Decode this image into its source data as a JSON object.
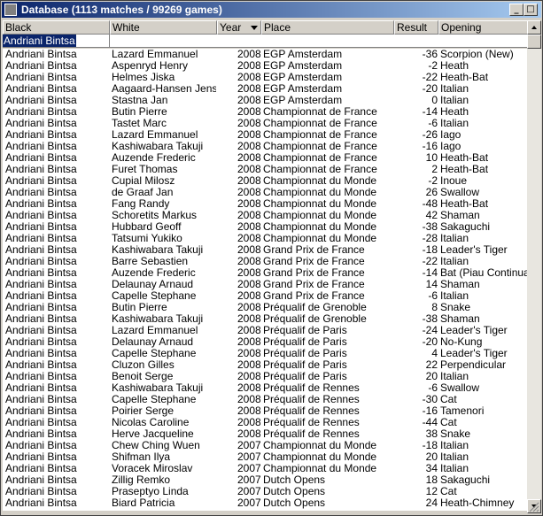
{
  "window": {
    "title": "Database (1113 matches / 99269 games)",
    "min_label": "_",
    "max_label": "□",
    "close_label": "×"
  },
  "columns": [
    "Black",
    "White",
    "Year",
    "Place",
    "Result",
    "Opening"
  ],
  "filter": {
    "black": "Andriani Bintsa"
  },
  "rows": [
    [
      "Andriani Bintsa",
      "Lazard Emmanuel",
      "2008",
      "EGP Amsterdam",
      "-36",
      "Scorpion (New)"
    ],
    [
      "Andriani Bintsa",
      "Aspenryd Henry",
      "2008",
      "EGP Amsterdam",
      "-2",
      "Heath"
    ],
    [
      "Andriani Bintsa",
      "Helmes Jiska",
      "2008",
      "EGP Amsterdam",
      "-22",
      "Heath-Bat"
    ],
    [
      "Andriani Bintsa",
      "Aagaard-Hansen Jens",
      "2008",
      "EGP Amsterdam",
      "-20",
      "Italian"
    ],
    [
      "Andriani Bintsa",
      "Stastna Jan",
      "2008",
      "EGP Amsterdam",
      "0",
      "Italian"
    ],
    [
      "Andriani Bintsa",
      "Butin Pierre",
      "2008",
      "Championnat de France",
      "-14",
      "Heath"
    ],
    [
      "Andriani Bintsa",
      "Tastet Marc",
      "2008",
      "Championnat de France",
      "-6",
      "Italian"
    ],
    [
      "Andriani Bintsa",
      "Lazard Emmanuel",
      "2008",
      "Championnat de France",
      "-26",
      "Iago"
    ],
    [
      "Andriani Bintsa",
      "Kashiwabara Takuji",
      "2008",
      "Championnat de France",
      "-16",
      "Iago"
    ],
    [
      "Andriani Bintsa",
      "Auzende Frederic",
      "2008",
      "Championnat de France",
      "10",
      "Heath-Bat"
    ],
    [
      "Andriani Bintsa",
      "Furet Thomas",
      "2008",
      "Championnat de France",
      "2",
      "Heath-Bat"
    ],
    [
      "Andriani Bintsa",
      "Cupial Milosz",
      "2008",
      "Championnat du Monde",
      "-2",
      "Inoue"
    ],
    [
      "Andriani Bintsa",
      "de Graaf Jan",
      "2008",
      "Championnat du Monde",
      "26",
      "Swallow"
    ],
    [
      "Andriani Bintsa",
      "Fang Randy",
      "2008",
      "Championnat du Monde",
      "-48",
      "Heath-Bat"
    ],
    [
      "Andriani Bintsa",
      "Schoretits Markus",
      "2008",
      "Championnat du Monde",
      "42",
      "Shaman"
    ],
    [
      "Andriani Bintsa",
      "Hubbard Geoff",
      "2008",
      "Championnat du Monde",
      "-38",
      "Sakaguchi"
    ],
    [
      "Andriani Bintsa",
      "Tatsumi Yukiko",
      "2008",
      "Championnat du Monde",
      "-28",
      "Italian"
    ],
    [
      "Andriani Bintsa",
      "Kashiwabara Takuji",
      "2008",
      "Grand Prix de France",
      "-18",
      "Leader's Tiger"
    ],
    [
      "Andriani Bintsa",
      "Barre Sebastien",
      "2008",
      "Grand Prix de France",
      "-22",
      "Italian"
    ],
    [
      "Andriani Bintsa",
      "Auzende Frederic",
      "2008",
      "Grand Prix de France",
      "-14",
      "Bat (Piau Continuatio"
    ],
    [
      "Andriani Bintsa",
      "Delaunay Arnaud",
      "2008",
      "Grand Prix de France",
      "14",
      "Shaman"
    ],
    [
      "Andriani Bintsa",
      "Capelle Stephane",
      "2008",
      "Grand Prix de France",
      "-6",
      "Italian"
    ],
    [
      "Andriani Bintsa",
      "Butin Pierre",
      "2008",
      "Préqualif de Grenoble",
      "8",
      "Snake"
    ],
    [
      "Andriani Bintsa",
      "Kashiwabara Takuji",
      "2008",
      "Préqualif de Grenoble",
      "-38",
      "Shaman"
    ],
    [
      "Andriani Bintsa",
      "Lazard Emmanuel",
      "2008",
      "Préqualif de Paris",
      "-24",
      "Leader's Tiger"
    ],
    [
      "Andriani Bintsa",
      "Delaunay Arnaud",
      "2008",
      "Préqualif de Paris",
      "-20",
      "No-Kung"
    ],
    [
      "Andriani Bintsa",
      "Capelle Stephane",
      "2008",
      "Préqualif de Paris",
      "4",
      "Leader's Tiger"
    ],
    [
      "Andriani Bintsa",
      "Cluzon Gilles",
      "2008",
      "Préqualif de Paris",
      "22",
      "Perpendicular"
    ],
    [
      "Andriani Bintsa",
      "Benoit Serge",
      "2008",
      "Préqualif de Paris",
      "20",
      "Italian"
    ],
    [
      "Andriani Bintsa",
      "Kashiwabara Takuji",
      "2008",
      "Préqualif de Rennes",
      "-6",
      "Swallow"
    ],
    [
      "Andriani Bintsa",
      "Capelle Stephane",
      "2008",
      "Préqualif de Rennes",
      "-30",
      "Cat"
    ],
    [
      "Andriani Bintsa",
      "Poirier Serge",
      "2008",
      "Préqualif de Rennes",
      "-16",
      "Tamenori"
    ],
    [
      "Andriani Bintsa",
      "Nicolas Caroline",
      "2008",
      "Préqualif de Rennes",
      "-44",
      "Cat"
    ],
    [
      "Andriani Bintsa",
      "Herve Jacqueline",
      "2008",
      "Préqualif de Rennes",
      "38",
      "Snake"
    ],
    [
      "Andriani Bintsa",
      "Chew Ching Wuen",
      "2007",
      "Championnat du Monde",
      "-18",
      "Italian"
    ],
    [
      "Andriani Bintsa",
      "Shifman Ilya",
      "2007",
      "Championnat du Monde",
      "20",
      "Italian"
    ],
    [
      "Andriani Bintsa",
      "Voracek Miroslav",
      "2007",
      "Championnat du Monde",
      "34",
      "Italian"
    ],
    [
      "Andriani Bintsa",
      "Zillig Remko",
      "2007",
      "Dutch Opens",
      "18",
      "Sakaguchi"
    ],
    [
      "Andriani Bintsa",
      "Praseptyo Linda",
      "2007",
      "Dutch Opens",
      "12",
      "Cat"
    ],
    [
      "Andriani Bintsa",
      "Biard Patricia",
      "2007",
      "Dutch Opens",
      "24",
      "Heath-Chimney"
    ]
  ],
  "icons": {
    "window": "database-icon",
    "sort": "sort-down-arrow-icon",
    "scroll_up": "scroll-up-arrow-icon",
    "scroll_down": "scroll-down-arrow-icon"
  },
  "colors": {
    "title_bar": "#0a246a",
    "selection": "#0a246a",
    "face": "#d4d0c8"
  }
}
